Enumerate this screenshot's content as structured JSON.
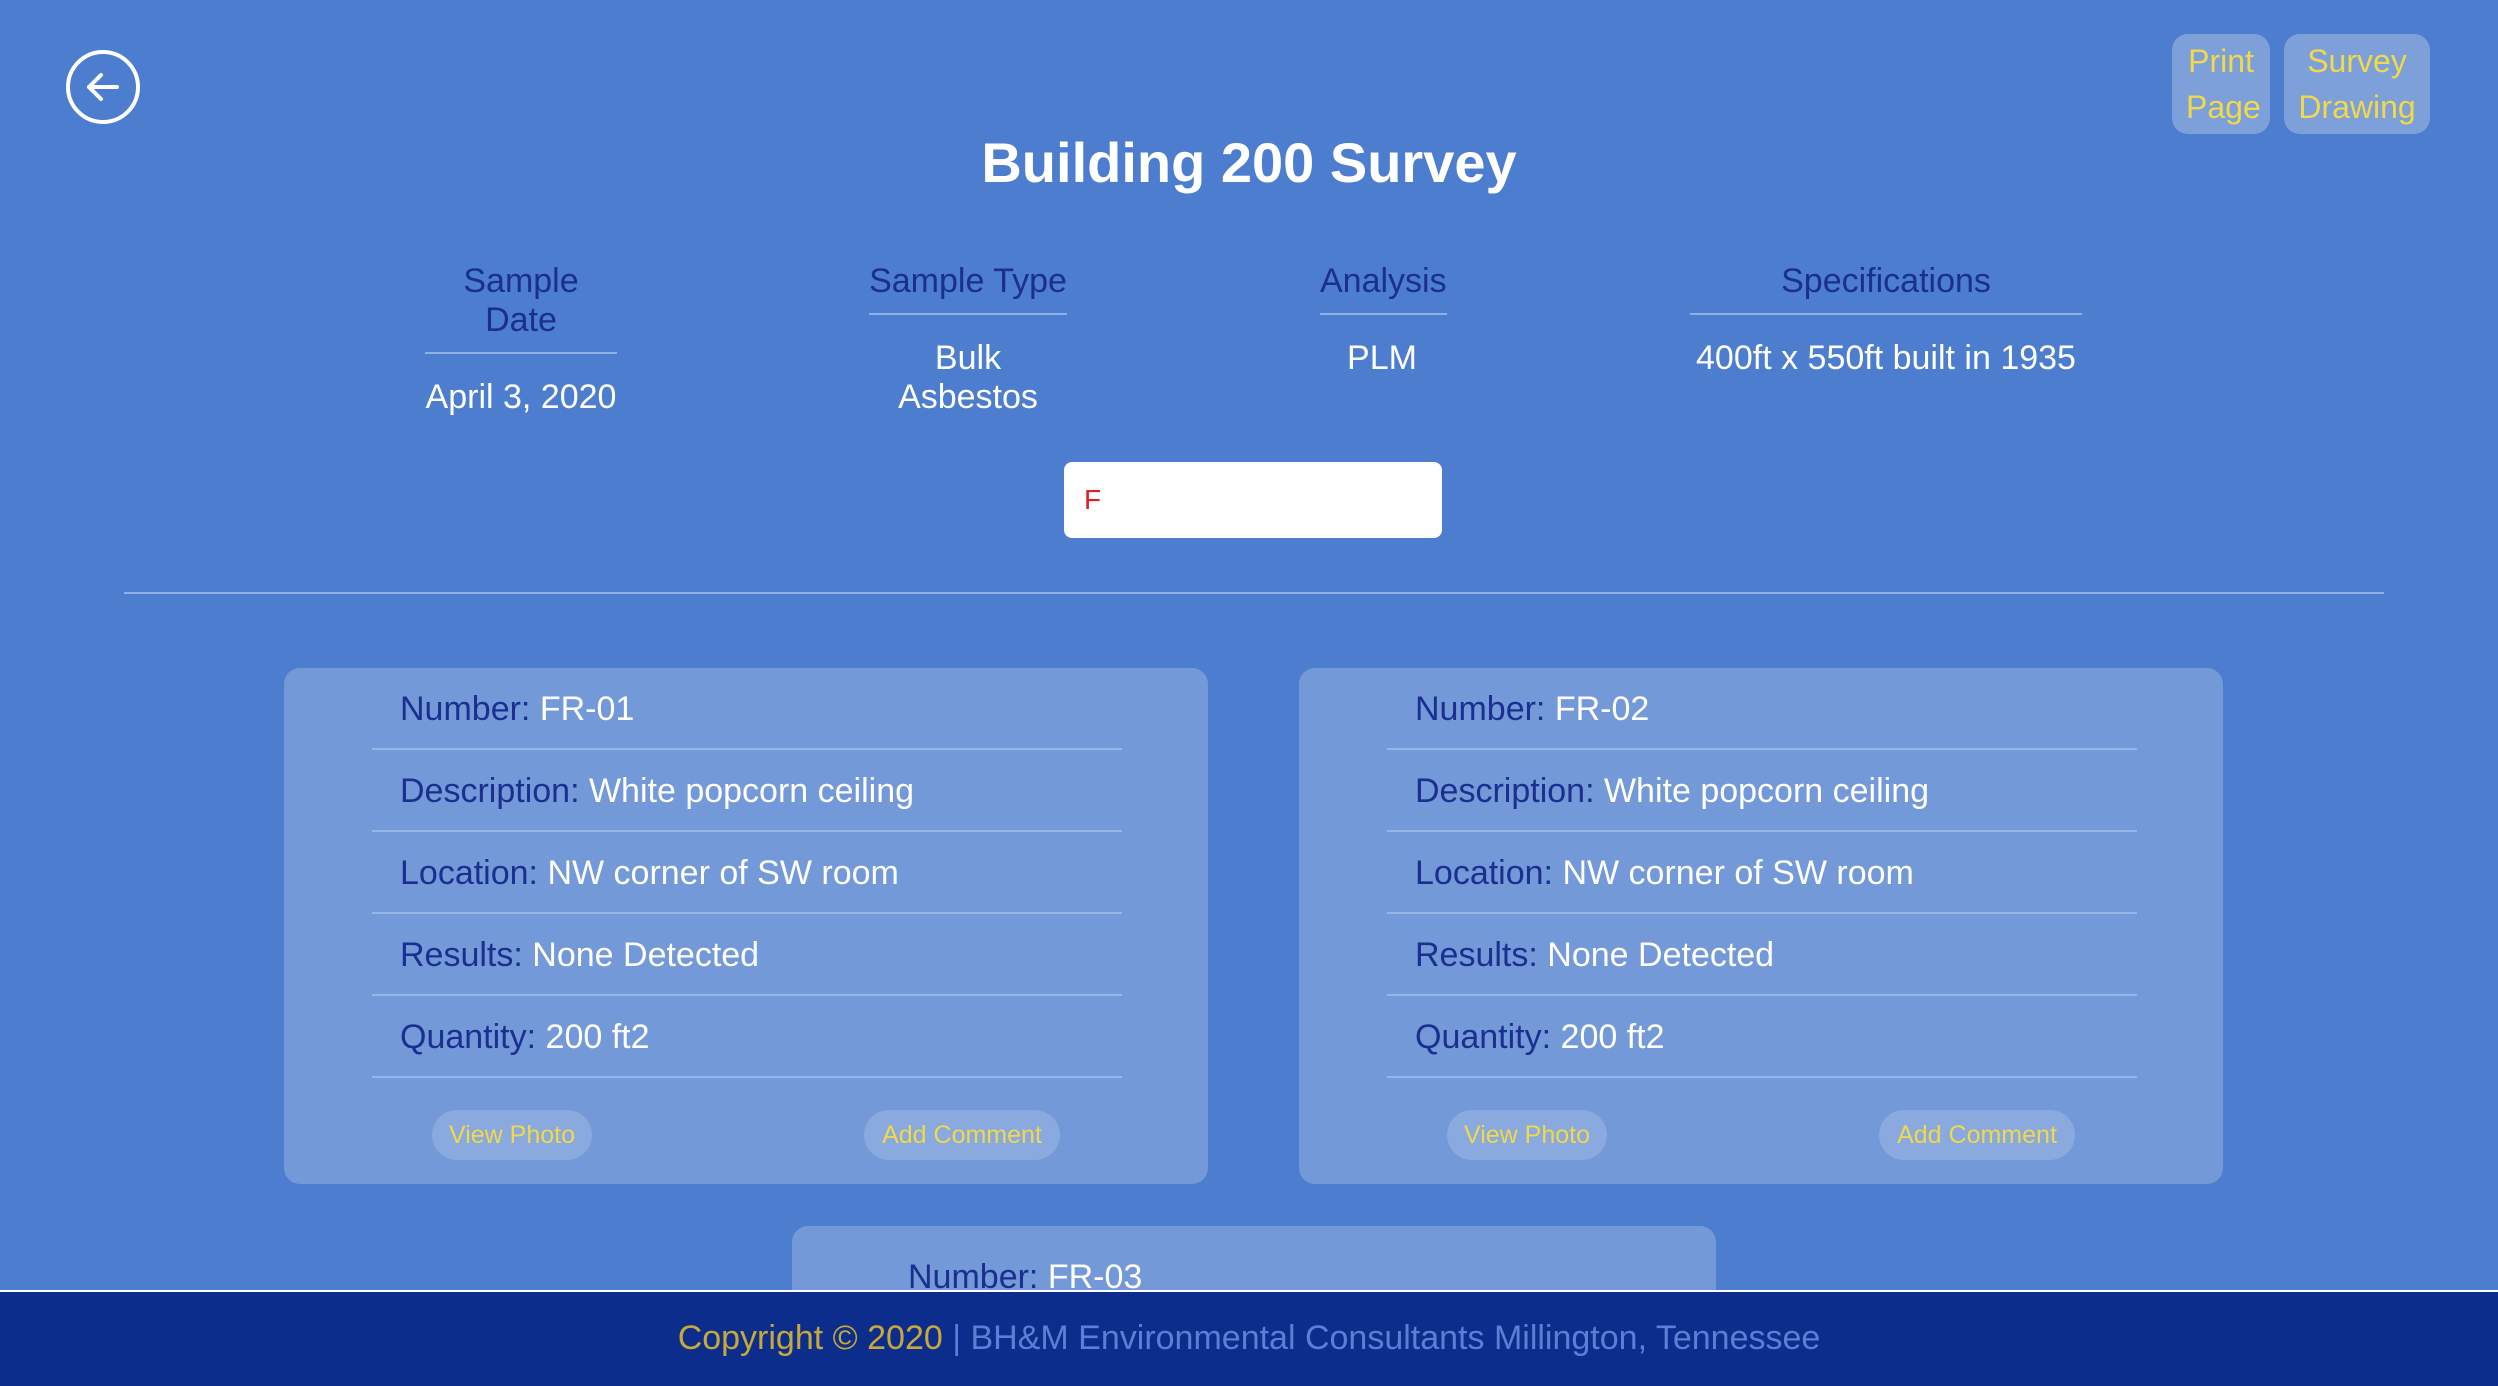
{
  "header": {
    "back_icon": "arrow-left-circle-icon",
    "print_line1": "Print",
    "print_line2": "Page",
    "survey_line1": "Survey",
    "survey_line2": "Drawing",
    "title": "Building 200 Survey"
  },
  "info": {
    "sample_date_label": "Sample Date",
    "sample_date_value": "April 3, 2020",
    "sample_type_label": "Sample Type",
    "sample_type_value": "Bulk Asbestos",
    "analysis_label": "Analysis",
    "analysis_value": "PLM",
    "specifications_label": "Specifications",
    "specifications_value": "400ft x 550ft built in 1935"
  },
  "search": {
    "value": "F"
  },
  "labels": {
    "number": "Number:",
    "description": "Description:",
    "location": "Location:",
    "results": "Results:",
    "quantity": "Quantity:",
    "view_photo": "View Photo",
    "add_comment": "Add Comment"
  },
  "samples": [
    {
      "number": "FR-01",
      "description": "White popcorn ceiling",
      "location": "NW corner of SW room",
      "results": "None Detected",
      "quantity": "200 ft2"
    },
    {
      "number": "FR-02",
      "description": "White popcorn ceiling",
      "location": "NW corner of SW room",
      "results": "None Detected",
      "quantity": "200 ft2"
    },
    {
      "number": "FR-03"
    }
  ],
  "footer": {
    "copyright": "Copyright © 2020",
    "company": " | BH&M Environmental Consultants Millington, Tennessee"
  },
  "colors": {
    "background": "#4d7dce",
    "card": "#7399d8",
    "label_text": "#1a2f8f",
    "button_text": "#f0d94a",
    "footer_bg": "#0c2d8c",
    "search_text": "#e02020"
  }
}
